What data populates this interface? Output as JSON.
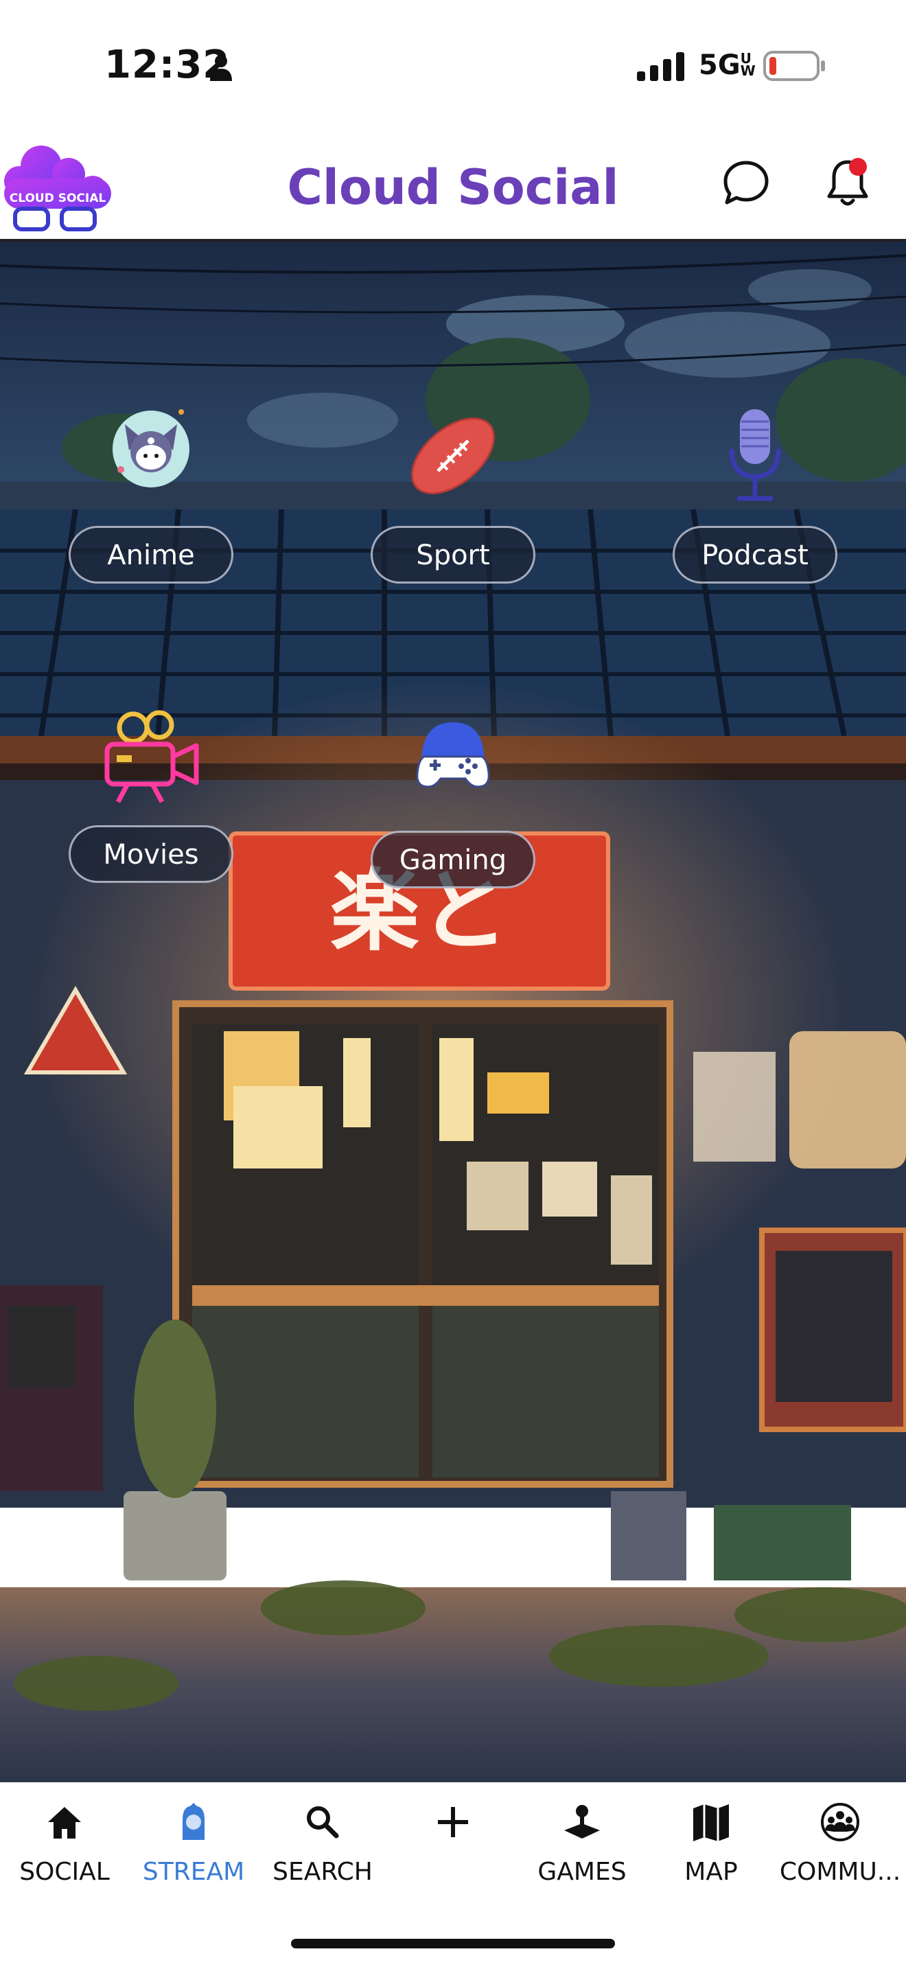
{
  "status_bar": {
    "time": "12:32",
    "network": "5G",
    "network_sup": "UW",
    "icons": [
      "person-icon",
      "signal-bars-icon",
      "battery-low-icon"
    ],
    "battery_color": "#e23a2e"
  },
  "header": {
    "logo_text": "CLOUD SOCIAL",
    "title": "Cloud Social",
    "title_color": "#6a3fb8",
    "icons": [
      "chat-bubble-icon",
      "notification-bell-icon"
    ],
    "notification_dot_color": "#e5202e"
  },
  "categories": [
    {
      "label": "Anime",
      "icon": "anime-character-icon"
    },
    {
      "label": "Sport",
      "icon": "football-icon"
    },
    {
      "label": "Podcast",
      "icon": "microphone-icon"
    },
    {
      "label": "Movies",
      "icon": "movie-camera-icon"
    },
    {
      "label": "Gaming",
      "icon": "game-controller-icon"
    }
  ],
  "scene": {
    "sign_text": "楽と"
  },
  "bottom_nav": {
    "active_color": "#3a7bd5",
    "items": [
      {
        "label": "SOCIAL",
        "icon": "home-icon"
      },
      {
        "label": "STREAM",
        "icon": "stream-avatar-icon",
        "active": true
      },
      {
        "label": "SEARCH",
        "icon": "search-icon"
      },
      {
        "label": "",
        "icon": "plus-icon"
      },
      {
        "label": "GAMES",
        "icon": "joystick-icon"
      },
      {
        "label": "MAP",
        "icon": "map-icon"
      },
      {
        "label": "COMMU...",
        "icon": "community-icon"
      }
    ]
  }
}
